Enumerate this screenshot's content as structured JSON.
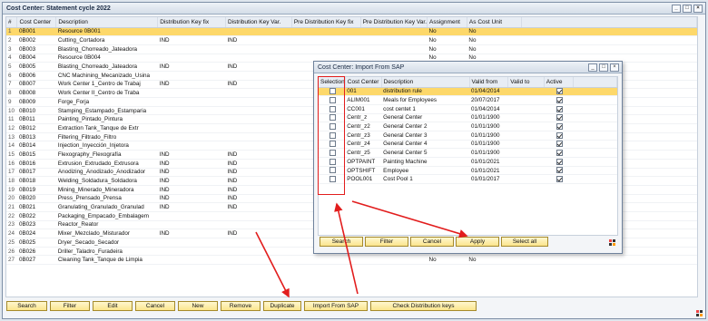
{
  "main": {
    "title": "Cost Center: Statement cycle 2022",
    "window_buttons": [
      "_",
      "□",
      "×"
    ],
    "columns": [
      "#",
      "Cost Center",
      "Description",
      "Distribution Key fix",
      "Distribution Key Var.",
      "Pre Distribution Key fix",
      "Pre Distribution Key Var.",
      "Assignment",
      "As Cost Unit"
    ],
    "rows": [
      [
        "1",
        "0B001",
        "Resource 0B001",
        "",
        "",
        "",
        "",
        "No",
        "No"
      ],
      [
        "2",
        "0B002",
        "Cutting_Cortadora",
        "IND",
        "IND",
        "",
        "",
        "No",
        "No"
      ],
      [
        "3",
        "0B003",
        "Blasting_Chorreado_Jateadora",
        "",
        "",
        "",
        "",
        "No",
        "No"
      ],
      [
        "4",
        "0B004",
        "Resource 0B004",
        "",
        "",
        "",
        "",
        "No",
        "No"
      ],
      [
        "5",
        "0B005",
        "Blasting_Chorreado_Jateadora",
        "IND",
        "IND",
        "",
        "",
        "No",
        "No"
      ],
      [
        "6",
        "0B006",
        "CNC Machining_Mecanizado_Usina",
        "",
        "",
        "",
        "",
        "No",
        "No"
      ],
      [
        "7",
        "0B007",
        "Work Center 1_Centro de Trabaj",
        "IND",
        "IND",
        "",
        "",
        "No",
        "No"
      ],
      [
        "8",
        "0B008",
        "Work Center II_Centro de Traba",
        "",
        "",
        "",
        "",
        "No",
        "No"
      ],
      [
        "9",
        "0B009",
        "Forge_Forja",
        "",
        "",
        "",
        "",
        "No",
        "No"
      ],
      [
        "10",
        "0B010",
        "Stamping_Estampado_Estamparia",
        "",
        "",
        "",
        "",
        "No",
        "No"
      ],
      [
        "11",
        "0B011",
        "Painting_Pintado_Pintura",
        "",
        "",
        "",
        "",
        "No",
        "No"
      ],
      [
        "12",
        "0B012",
        "Extraction Tank_Tanque de Extr",
        "",
        "",
        "",
        "",
        "No",
        "No"
      ],
      [
        "13",
        "0B013",
        "Filtering_Filtrado_Filtro",
        "",
        "",
        "",
        "",
        "No",
        "No"
      ],
      [
        "14",
        "0B014",
        "Injection_Inyección_Injetora",
        "",
        "",
        "",
        "",
        "No",
        "No"
      ],
      [
        "15",
        "0B015",
        "Flexography_Flexografía",
        "IND",
        "IND",
        "",
        "",
        "No",
        "No"
      ],
      [
        "16",
        "0B016",
        "Extrusion_Extrudado_Extrusora",
        "IND",
        "IND",
        "",
        "",
        "No",
        "No"
      ],
      [
        "17",
        "0B017",
        "Anodizing_Anodizado_Anodizador",
        "IND",
        "IND",
        "",
        "",
        "No",
        "No"
      ],
      [
        "18",
        "0B018",
        "Welding_Soldadura_Soldadora",
        "IND",
        "IND",
        "",
        "",
        "No",
        "No"
      ],
      [
        "19",
        "0B019",
        "Mining_Minerado_Mineradora",
        "IND",
        "IND",
        "",
        "",
        "No",
        "No"
      ],
      [
        "20",
        "0B020",
        "Press_Prensado_Prensa",
        "IND",
        "IND",
        "",
        "",
        "No",
        "No"
      ],
      [
        "21",
        "0B021",
        "Granulating_Granulado_Granulad",
        "IND",
        "IND",
        "",
        "",
        "No",
        "No"
      ],
      [
        "22",
        "0B022",
        "Packaging_Empacado_Embalagem",
        "",
        "",
        "",
        "",
        "No",
        "No"
      ],
      [
        "23",
        "0B023",
        "Reactor_Reator",
        "",
        "",
        "",
        "",
        "No",
        "No"
      ],
      [
        "24",
        "0B024",
        "Mixer_Mezclado_Misturador",
        "IND",
        "IND",
        "",
        "",
        "No",
        "No"
      ],
      [
        "25",
        "0B025",
        "Dryer_Secado_Secador",
        "",
        "",
        "",
        "",
        "No",
        "No"
      ],
      [
        "26",
        "0B026",
        "Driller_Taladro_Furadeira",
        "",
        "",
        "",
        "",
        "No",
        "No"
      ],
      [
        "27",
        "0B027",
        "Cleaning Tank_Tanque de Limpia",
        "",
        "",
        "",
        "",
        "No",
        "No"
      ]
    ],
    "buttons": [
      "Search",
      "Filter",
      "Edit",
      "Cancel",
      "New",
      "Remove",
      "Duplicate",
      "Import From SAP",
      "Check Distribution keys"
    ]
  },
  "dialog": {
    "title": "Cost Center: Import From SAP",
    "window_buttons": [
      "_",
      "□",
      "×"
    ],
    "columns": [
      "Selection",
      "Cost Center",
      "Description",
      "Valid from",
      "Valid to",
      "Active"
    ],
    "rows": [
      {
        "checked": false,
        "cost_center": "001",
        "description": "distribution rule",
        "valid_from": "01/04/2014",
        "valid_to": "",
        "active": true
      },
      {
        "checked": false,
        "cost_center": "ALIM001",
        "description": "Meals for Employees",
        "valid_from": "20/07/2017",
        "valid_to": "",
        "active": true
      },
      {
        "checked": false,
        "cost_center": "CC001",
        "description": "cost centet 1",
        "valid_from": "01/04/2014",
        "valid_to": "",
        "active": true
      },
      {
        "checked": false,
        "cost_center": "Centr_z",
        "description": "General Center",
        "valid_from": "01/01/1900",
        "valid_to": "",
        "active": true
      },
      {
        "checked": false,
        "cost_center": "Centr_z2",
        "description": "General Center 2",
        "valid_from": "01/01/1900",
        "valid_to": "",
        "active": true
      },
      {
        "checked": false,
        "cost_center": "Centr_z3",
        "description": "General Center 3",
        "valid_from": "01/01/1900",
        "valid_to": "",
        "active": true
      },
      {
        "checked": false,
        "cost_center": "Centr_z4",
        "description": "General Center 4",
        "valid_from": "01/01/1900",
        "valid_to": "",
        "active": true
      },
      {
        "checked": false,
        "cost_center": "Centr_z5",
        "description": "General Center 5",
        "valid_from": "01/01/1900",
        "valid_to": "",
        "active": true
      },
      {
        "checked": false,
        "cost_center": "OPTPAINT",
        "description": "Painting Machine",
        "valid_from": "01/01/2021",
        "valid_to": "",
        "active": true
      },
      {
        "checked": false,
        "cost_center": "OPTSHIFT",
        "description": "Employee",
        "valid_from": "01/01/2021",
        "valid_to": "",
        "active": true
      },
      {
        "checked": false,
        "cost_center": "POOL001",
        "description": "Cost Pool 1",
        "valid_from": "01/01/2017",
        "valid_to": "",
        "active": true
      }
    ],
    "buttons": [
      "Search",
      "Filter",
      "Cancel",
      "Apply",
      "Select all"
    ]
  },
  "colors": {
    "selected_row": "#fdd86a",
    "button": "#fbe58c",
    "annotation": "#e21d1d"
  }
}
